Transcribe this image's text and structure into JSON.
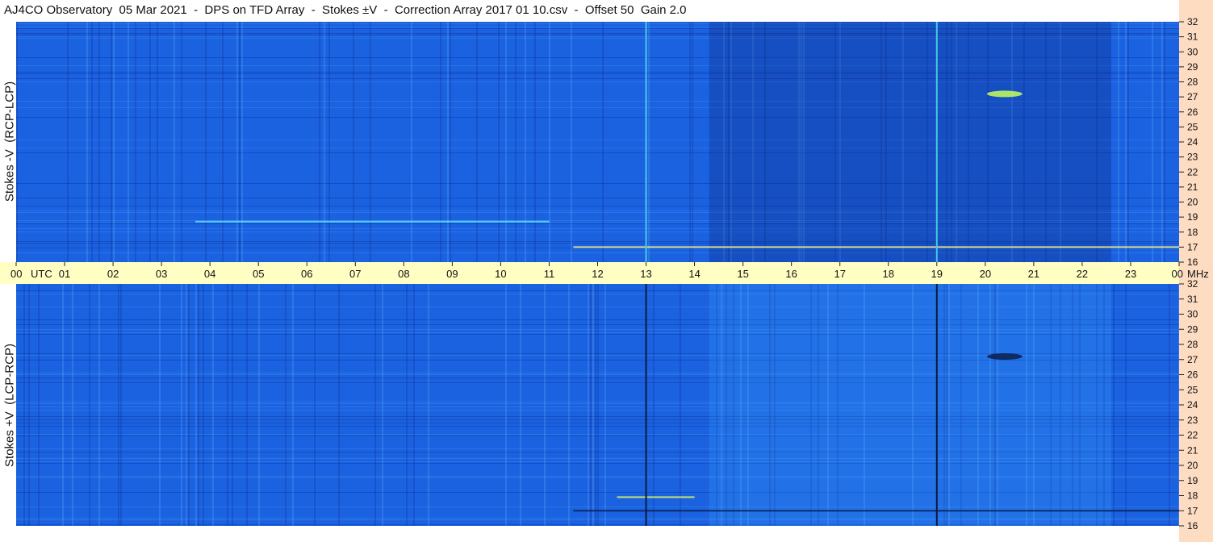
{
  "title": "AJ4CO Observatory  05 Mar 2021  -  DPS on TFD Array  -  Stokes ±V  -  Correction Array 2017 01 10.csv  -  Offset 50  Gain 2.0",
  "colors": {
    "background_base": "#1b62e0",
    "time_bar": "#ffffc4",
    "freq_strip": "#fddcc1"
  },
  "chart_data": [
    {
      "type": "heatmap",
      "panel": "top",
      "ylabel": "Stokes -V  (RCP-LCP)",
      "x_unit": "UTC",
      "y_unit": "MHz",
      "xlim": [
        0,
        24
      ],
      "ylim": [
        16,
        32
      ],
      "x_ticks": [
        "00",
        "01",
        "02",
        "03",
        "04",
        "05",
        "06",
        "07",
        "08",
        "09",
        "10",
        "11",
        "12",
        "13",
        "14",
        "15",
        "16",
        "17",
        "18",
        "19",
        "20",
        "21",
        "22",
        "23",
        "00"
      ],
      "y_ticks": [
        "16",
        "17",
        "18",
        "19",
        "20",
        "21",
        "22",
        "23",
        "24",
        "25",
        "26",
        "27",
        "28",
        "29",
        "30",
        "31",
        "32"
      ],
      "vertical_markers": [
        {
          "utc": 13.0,
          "color": "#49c8e8"
        },
        {
          "utc": 19.0,
          "color": "#49c8e8"
        }
      ],
      "features": [
        {
          "kind": "darker-band",
          "from_utc": 14.3,
          "to_utc": 22.6,
          "level": "dark"
        },
        {
          "kind": "burst",
          "utc": 20.4,
          "mhz": 27.2,
          "color": "#c8ff5a"
        },
        {
          "kind": "streak",
          "from_utc": 11.5,
          "to_utc": 24.0,
          "mhz": 17.0,
          "color": "#ffff8c"
        },
        {
          "kind": "streak",
          "from_utc": 3.7,
          "to_utc": 11.0,
          "mhz": 18.7,
          "color": "#66e6ff"
        }
      ]
    },
    {
      "type": "heatmap",
      "panel": "bottom",
      "ylabel": "Stokes +V  (LCP-RCP)",
      "x_unit": "UTC",
      "y_unit": "MHz",
      "xlim": [
        0,
        24
      ],
      "ylim": [
        16,
        32
      ],
      "x_ticks": [
        "00",
        "01",
        "02",
        "03",
        "04",
        "05",
        "06",
        "07",
        "08",
        "09",
        "10",
        "11",
        "12",
        "13",
        "14",
        "15",
        "16",
        "17",
        "18",
        "19",
        "20",
        "21",
        "22",
        "23",
        "00"
      ],
      "y_ticks": [
        "16",
        "17",
        "18",
        "19",
        "20",
        "21",
        "22",
        "23",
        "24",
        "25",
        "26",
        "27",
        "28",
        "29",
        "30",
        "31",
        "32"
      ],
      "vertical_markers": [
        {
          "utc": 13.0,
          "color": "#081a40"
        },
        {
          "utc": 19.0,
          "color": "#081a40"
        }
      ],
      "features": [
        {
          "kind": "brighter-band",
          "from_utc": 14.3,
          "to_utc": 22.6,
          "level": "bright"
        },
        {
          "kind": "burst",
          "utc": 20.4,
          "mhz": 27.2,
          "color": "#0a1e4a"
        },
        {
          "kind": "streak",
          "from_utc": 11.5,
          "to_utc": 24.0,
          "mhz": 17.0,
          "color": "#0a1e4a"
        },
        {
          "kind": "streak",
          "from_utc": 12.4,
          "to_utc": 14.0,
          "mhz": 17.9,
          "color": "#e6ff5a"
        }
      ]
    }
  ],
  "time_axis": {
    "labels": [
      "00",
      "01",
      "02",
      "03",
      "04",
      "05",
      "06",
      "07",
      "08",
      "09",
      "10",
      "11",
      "12",
      "13",
      "14",
      "15",
      "16",
      "17",
      "18",
      "19",
      "20",
      "21",
      "22",
      "23",
      "00"
    ],
    "utc_label": "UTC",
    "mhz_label": "MHz"
  }
}
